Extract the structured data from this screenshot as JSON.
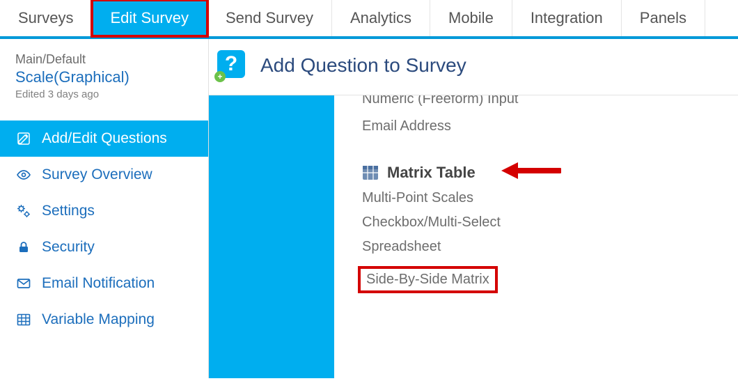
{
  "topnav": {
    "tabs": [
      {
        "label": "Surveys"
      },
      {
        "label": "Edit Survey",
        "active": true,
        "highlight": true
      },
      {
        "label": "Send Survey"
      },
      {
        "label": "Analytics"
      },
      {
        "label": "Mobile"
      },
      {
        "label": "Integration"
      },
      {
        "label": "Panels"
      }
    ]
  },
  "sidebar": {
    "path": "Main/Default",
    "title": "Scale(Graphical)",
    "edited": "Edited 3 days ago",
    "items": [
      {
        "icon": "edit",
        "label": "Add/Edit Questions",
        "active": true
      },
      {
        "icon": "eye",
        "label": "Survey Overview"
      },
      {
        "icon": "gear",
        "label": "Settings"
      },
      {
        "icon": "lock",
        "label": "Security"
      },
      {
        "icon": "mail",
        "label": "Email Notification"
      },
      {
        "icon": "grid",
        "label": "Variable Mapping"
      }
    ]
  },
  "content": {
    "header": "Add Question to Survey",
    "truncated_top": "Numeric (Freeform) Input",
    "prev_items": [
      "Email Address"
    ],
    "section_title": "Matrix Table",
    "section_items": [
      "Multi-Point Scales",
      "Checkbox/Multi-Select",
      "Spreadsheet",
      "Side-By-Side Matrix"
    ],
    "highlight_item_index": 3
  }
}
